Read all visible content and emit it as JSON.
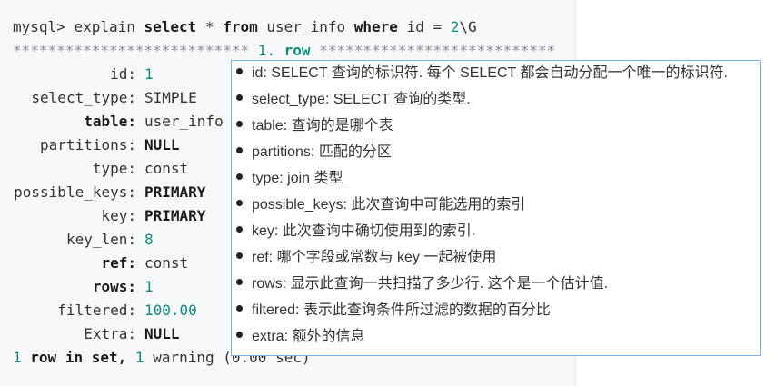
{
  "terminal": {
    "prompt": "mysql>",
    "command_pre": "explain",
    "command_select": "select",
    "command_star": "*",
    "command_from": "from",
    "command_table": "user_info",
    "command_where": "where",
    "command_cond": "id =",
    "command_num": "2",
    "command_suffix": "\\G",
    "separator_left": "***************************",
    "row_header_num": "1.",
    "row_header_word": "row",
    "separator_right": "***************************",
    "rows": [
      {
        "key": "id:",
        "value": "1",
        "key_bold": false,
        "value_class": "num"
      },
      {
        "key": "select_type:",
        "value": "SIMPLE",
        "key_bold": false,
        "value_class": ""
      },
      {
        "key": "table:",
        "value": "user_info",
        "key_bold": true,
        "value_class": ""
      },
      {
        "key": "partitions:",
        "value": "NULL",
        "key_bold": false,
        "value_class": "kw"
      },
      {
        "key": "type:",
        "value": "const",
        "key_bold": false,
        "value_class": ""
      },
      {
        "key": "possible_keys:",
        "value": "PRIMARY",
        "key_bold": false,
        "value_class": "kw"
      },
      {
        "key": "key:",
        "value": "PRIMARY",
        "key_bold": false,
        "value_class": "kw"
      },
      {
        "key": "key_len:",
        "value": "8",
        "key_bold": false,
        "value_class": "num"
      },
      {
        "key": "ref:",
        "value": "const",
        "key_bold": true,
        "value_class": ""
      },
      {
        "key": "rows:",
        "value": "1",
        "key_bold": true,
        "value_class": "num"
      },
      {
        "key": "filtered:",
        "value": "100.00",
        "key_bold": false,
        "value_class": "num"
      },
      {
        "key": "Extra:",
        "value": "NULL",
        "key_bold": false,
        "value_class": "kw"
      }
    ],
    "footer_num": "1",
    "footer_row": "row",
    "footer_in": "in",
    "footer_set": "set,",
    "footer_num2": "1",
    "footer_warning": "warning",
    "footer_time": "(0.00 sec)"
  },
  "tooltip": {
    "items": [
      "id: SELECT 查询的标识符. 每个 SELECT 都会自动分配一个唯一的标识符.",
      "select_type: SELECT 查询的类型.",
      "table: 查询的是哪个表",
      "partitions: 匹配的分区",
      "type: join 类型",
      "possible_keys: 此次查询中可能选用的索引",
      "key: 此次查询中确切使用到的索引.",
      "ref: 哪个字段或常数与 key 一起被使用",
      "rows: 显示此查询一共扫描了多少行. 这个是一个估计值.",
      "filtered: 表示此查询条件所过滤的数据的百分比",
      "extra: 额外的信息"
    ]
  }
}
